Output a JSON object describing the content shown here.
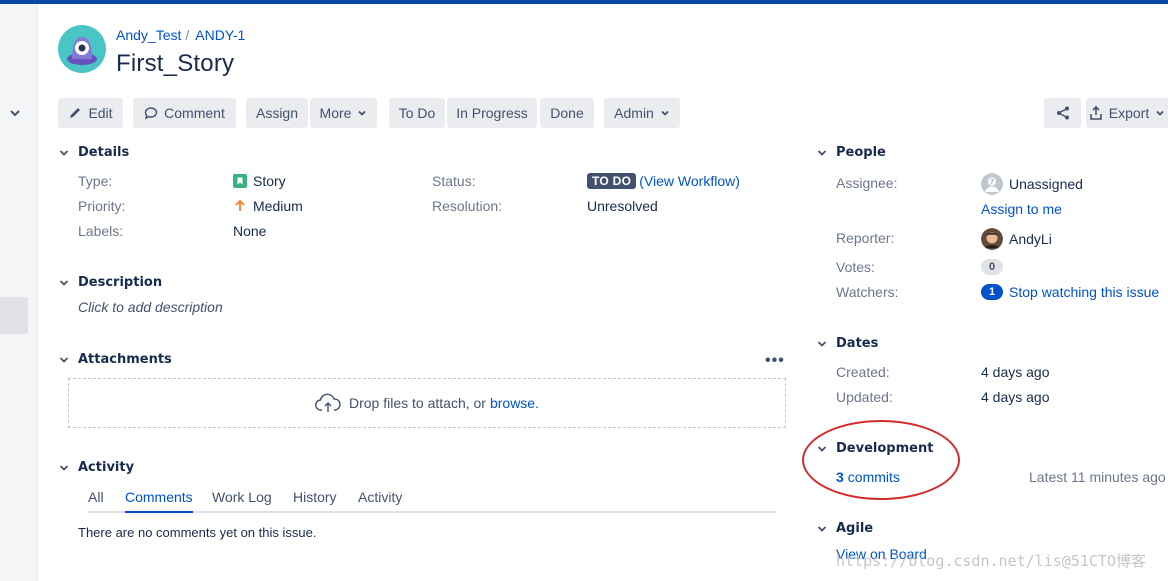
{
  "theme": {
    "accent": "#0052cc",
    "topbar": "#0747a6",
    "annotation": "#d42a2a"
  },
  "breadcrumb": {
    "project": "Andy_Test",
    "separator": "/",
    "issue_key": "ANDY-1"
  },
  "issue": {
    "title": "First_Story"
  },
  "toolbar": {
    "edit": "Edit",
    "comment": "Comment",
    "assign": "Assign",
    "more": "More",
    "todo": "To Do",
    "in_progress": "In Progress",
    "done": "Done",
    "admin": "Admin",
    "export": "Export"
  },
  "details": {
    "heading": "Details",
    "type_label": "Type:",
    "type_value": "Story",
    "priority_label": "Priority:",
    "priority_value": "Medium",
    "labels_label": "Labels:",
    "labels_value": "None",
    "status_label": "Status:",
    "status_value": "TO DO",
    "workflow_link": "(View Workflow)",
    "resolution_label": "Resolution:",
    "resolution_value": "Unresolved"
  },
  "description": {
    "heading": "Description",
    "placeholder": "Click to add description"
  },
  "attachments": {
    "heading": "Attachments",
    "more": "•••",
    "drop_text": "Drop files to attach, or",
    "browse": "browse."
  },
  "activity": {
    "heading": "Activity",
    "tabs": [
      "All",
      "Comments",
      "Work Log",
      "History",
      "Activity"
    ],
    "active_tab": "Comments",
    "empty": "There are no comments yet on this issue."
  },
  "people": {
    "heading": "People",
    "assignee_label": "Assignee:",
    "assignee_value": "Unassigned",
    "assign_to_me": "Assign to me",
    "reporter_label": "Reporter:",
    "reporter_value": "AndyLi",
    "votes_label": "Votes:",
    "votes_value": "0",
    "watchers_label": "Watchers:",
    "watchers_count": "1",
    "watchers_link": "Stop watching this issue"
  },
  "dates": {
    "heading": "Dates",
    "created_label": "Created:",
    "created_value": "4 days ago",
    "updated_label": "Updated:",
    "updated_value": "4 days ago"
  },
  "development": {
    "heading": "Development",
    "commits_count": "3",
    "commits_label": "commits",
    "latest": "Latest 11 minutes ago"
  },
  "agile": {
    "heading": "Agile",
    "view_on_board": "View on Board"
  },
  "watermark": "https://blog.csdn.net/lis@51CTO博客"
}
